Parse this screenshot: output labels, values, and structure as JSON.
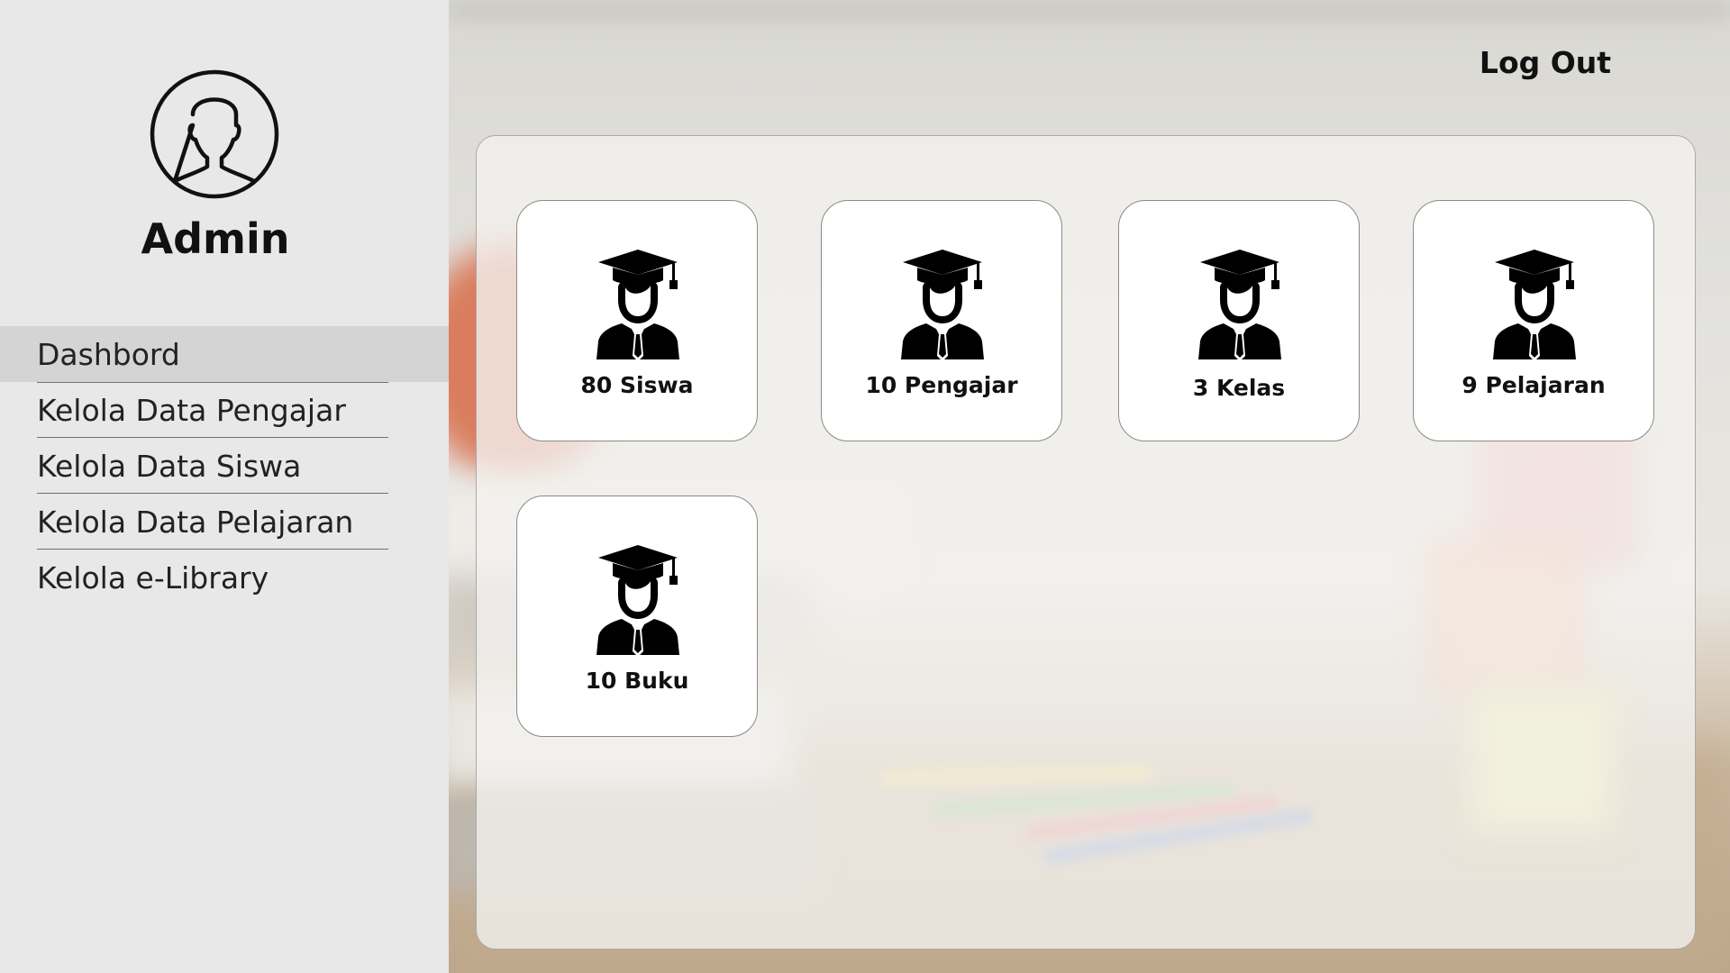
{
  "sidebar": {
    "user": {
      "name": "Admin",
      "avatar_icon": "user-avatar-icon"
    },
    "items": [
      {
        "label": "Dashbord",
        "active": true
      },
      {
        "label": "Kelola Data Pengajar",
        "active": false
      },
      {
        "label": "Kelola Data Siswa",
        "active": false
      },
      {
        "label": "Kelola Data Pelajaran",
        "active": false
      },
      {
        "label": "Kelola e-Library",
        "active": false
      }
    ]
  },
  "header": {
    "logout_label": "Log Out"
  },
  "dashboard": {
    "cards": [
      {
        "label": "80 Siswa",
        "icon": "graduate-icon"
      },
      {
        "label": "10 Pengajar",
        "icon": "graduate-icon"
      },
      {
        "label": "3 Kelas",
        "icon": "graduate-icon"
      },
      {
        "label": "9 Pelajaran",
        "icon": "graduate-icon"
      },
      {
        "label": "10 Buku",
        "icon": "graduate-icon"
      }
    ]
  },
  "colors": {
    "sidebar_bg": "#e8e8e8",
    "active_item_bg": "#d4d4d4",
    "card_bg": "#ffffff",
    "text": "#111111"
  }
}
